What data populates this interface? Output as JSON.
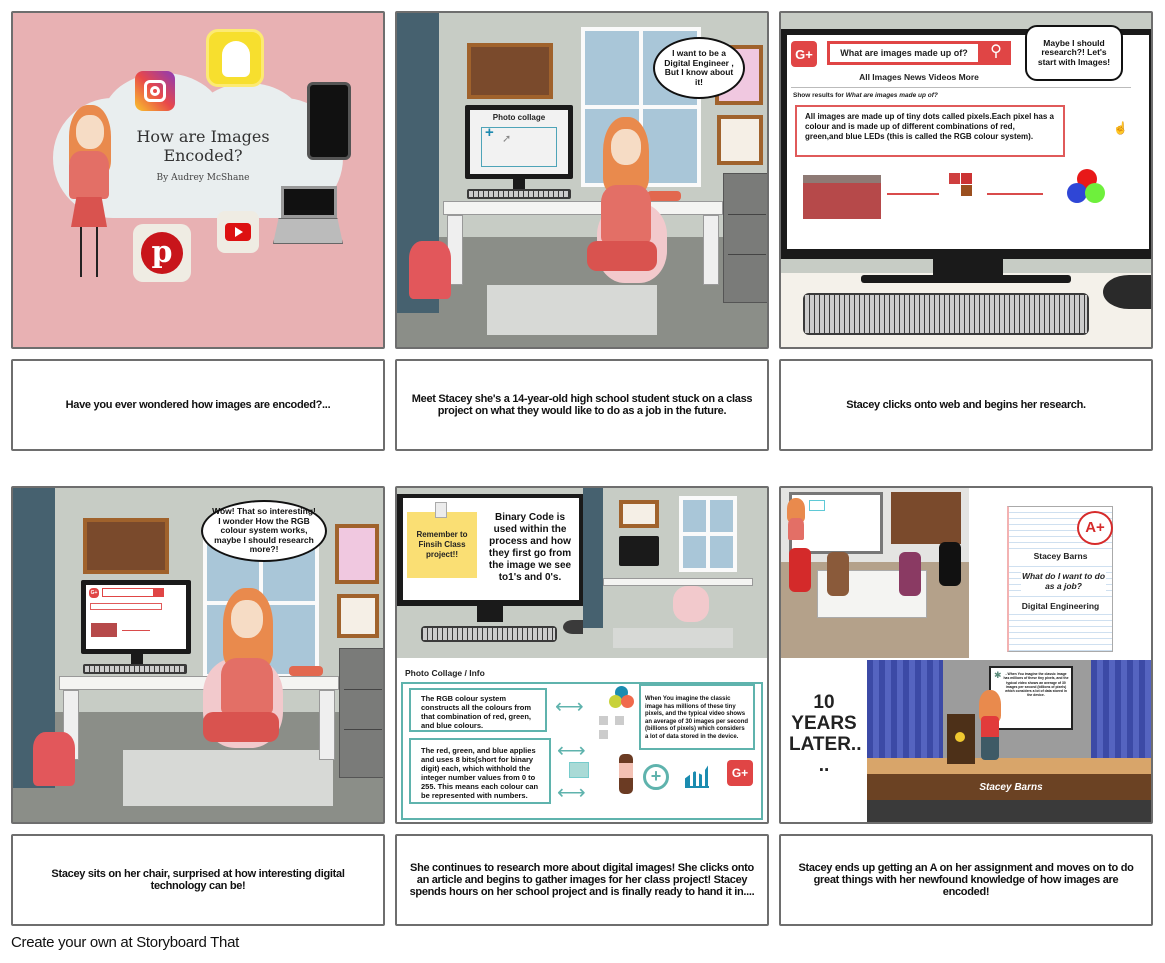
{
  "storyboard": {
    "panels": [
      {
        "id": 1,
        "scene": {
          "title_line1": "How are Images",
          "title_line2": "Encoded?",
          "byline": "By Audrey McShane",
          "icons": [
            "instagram-icon",
            "snapchat-icon",
            "smartphone-icon",
            "laptop-icon",
            "youtube-icon",
            "pinterest-icon"
          ],
          "background_color": "#e8b1b3"
        },
        "caption": "Have you ever wondered how images are encoded?..."
      },
      {
        "id": 2,
        "scene": {
          "speech": "I want to be a Digital Engineer , But I know about it!",
          "monitor_title": "Photo collage",
          "monitor_plus": "+"
        },
        "caption": "Meet Stacey she's a 14-year-old high school student stuck on a class project on what they would like to do as a job in the future."
      },
      {
        "id": 3,
        "scene": {
          "search_query": "What are images made up of?",
          "search_tabs": "All Images News Videos More",
          "show_results_prefix": "Show results for",
          "show_results_query": "What are images made up of?",
          "result_text": "All images are made up of tiny dots called pixels.Each pixel has a colour and is made up of different combinations of red, green,and blue LEDs (this is called the RGB colour system).",
          "speech": "Maybe I should research?! Let's start with Images!",
          "g_logo": "G+"
        },
        "caption": "Stacey clicks onto web and begins her research."
      },
      {
        "id": 4,
        "scene": {
          "speech": "Wow! That so interesting! I wonder How the RGB colour system works, maybe I should research more?!"
        },
        "caption": "Stacey sits on her chair, surprised at how interesting digital technology can be!"
      },
      {
        "id": 5,
        "scene": {
          "sticky_note": "Remember to Finsih Class project!!",
          "binary_text": "Binary Code is used within the process and how they first go from the image we see to1's and 0's.",
          "collage_title": "Photo Collage / Info",
          "box_rgb": "The RGB colour system constructs all the colours from that combination of red, green, and blue colours.",
          "box_bits": "The red, green, and blue applies and uses 8 bits(short for binary digit) each, which withhold the integer number values from 0 to 255. This means each colour can be represented with numbers.",
          "box_video": "When You imagine the classic image has millions of these tiny pixels, and the typical video shows an average of 30 images per second (billions of pixels) which considers a lot of data stored in the device.",
          "g_logo": "G+"
        },
        "caption": "She continues to research more about digital images! She clicks onto an article and begins to gather images for her class project! Stacey spends hours on her school project and is finally ready to hand it in...."
      },
      {
        "id": 6,
        "scene": {
          "grade": "A+",
          "paper_name": "Stacey Barns",
          "paper_question": "What do I want to do as a job?",
          "paper_answer": "Digital Engineering",
          "time_skip": "10 YEARS LATER.. ..",
          "stage_name": "Stacey Barns",
          "slide_text": "- When You imagine the classic image has millions of these tiny pixels, and the typical video shows an average of 30 images per second (billions of pixels) which considers a lot of data stored in the device."
        },
        "caption": "Stacey ends up getting an A on her assignment and moves on to do great things with her newfound knowledge of how images are encoded!"
      }
    ]
  },
  "footer": {
    "link_text": "Create your own at Storyboard That"
  },
  "colors": {
    "panel_border": "#6e6e6e",
    "accent_red": "#e04545",
    "teal": "#5fb3ad",
    "pink_bg": "#e8b1b3"
  }
}
